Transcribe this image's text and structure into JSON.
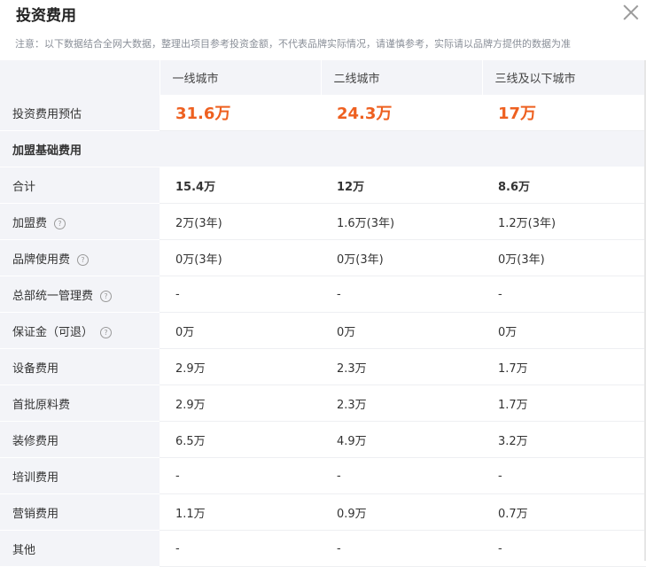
{
  "title": "投资费用",
  "notice": "注意：以下数据结合全网大数据，整理出项目参考投资金额，不代表品牌实际情况，请谨慎参考，实际请以品牌方提供的数据为准",
  "columns": [
    "一线城市",
    "二线城市",
    "三线及以下城市"
  ],
  "estimate": {
    "label": "投资费用预估",
    "values": [
      "31.6万",
      "24.3万",
      "17万"
    ]
  },
  "section_title": "加盟基础费用",
  "rows": [
    {
      "label": "合计",
      "help": false,
      "values": [
        "15.4万",
        "12万",
        "8.6万"
      ]
    },
    {
      "label": "加盟费",
      "help": true,
      "values": [
        "2万(3年)",
        "1.6万(3年)",
        "1.2万(3年)"
      ]
    },
    {
      "label": "品牌使用费",
      "help": true,
      "values": [
        "0万(3年)",
        "0万(3年)",
        "0万(3年)"
      ]
    },
    {
      "label": "总部统一管理费",
      "help": true,
      "values": [
        "-",
        "-",
        "-"
      ]
    },
    {
      "label": "保证金（可退）",
      "help": true,
      "values": [
        "0万",
        "0万",
        "0万"
      ]
    },
    {
      "label": "设备费用",
      "help": false,
      "values": [
        "2.9万",
        "2.3万",
        "1.7万"
      ]
    },
    {
      "label": "首批原料费",
      "help": false,
      "values": [
        "2.9万",
        "2.3万",
        "1.7万"
      ]
    },
    {
      "label": "装修费用",
      "help": false,
      "values": [
        "6.5万",
        "4.9万",
        "3.2万"
      ]
    },
    {
      "label": "培训费用",
      "help": false,
      "values": [
        "-",
        "-",
        "-"
      ]
    },
    {
      "label": "营销费用",
      "help": false,
      "values": [
        "1.1万",
        "0.9万",
        "0.7万"
      ]
    },
    {
      "label": "其他",
      "help": false,
      "values": [
        "-",
        "-",
        "-"
      ]
    }
  ],
  "help_glyph": "?",
  "colors": {
    "accent": "#ee6020",
    "label_bg": "#f3f4f8"
  }
}
